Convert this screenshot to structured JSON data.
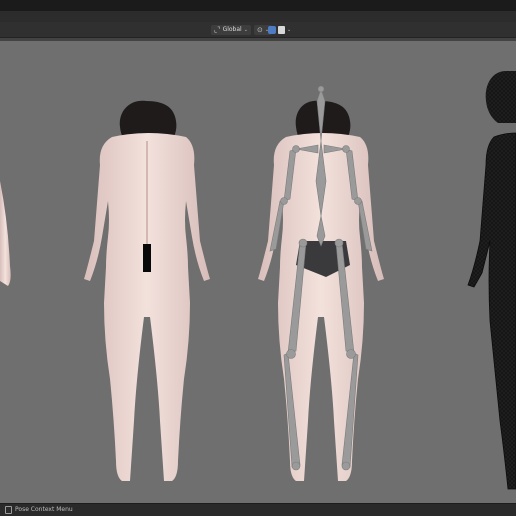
{
  "header": {
    "orientation": {
      "label": "Global",
      "icon": "transform-orientation-icon"
    },
    "pivot": {
      "icon": "pivot-point-icon"
    },
    "snap": {
      "icon": "snap-icon"
    },
    "proportional": {
      "icon": "proportional-editing-icon"
    }
  },
  "viewport": {
    "figures": [
      "clipped-figure-left",
      "textured-body-back",
      "rigged-body-back",
      "wireframe-body"
    ],
    "censor_bars": 2
  },
  "status": {
    "text": "Pose Context Menu",
    "icon": "mouse-icon"
  },
  "colors": {
    "viewport_bg": "#6f6f6f",
    "header_bg": "#303030",
    "skin": "#efd8d2",
    "hair": "#1e1a1a",
    "bone": "#9a9a9a",
    "wireframe": "#151515"
  }
}
